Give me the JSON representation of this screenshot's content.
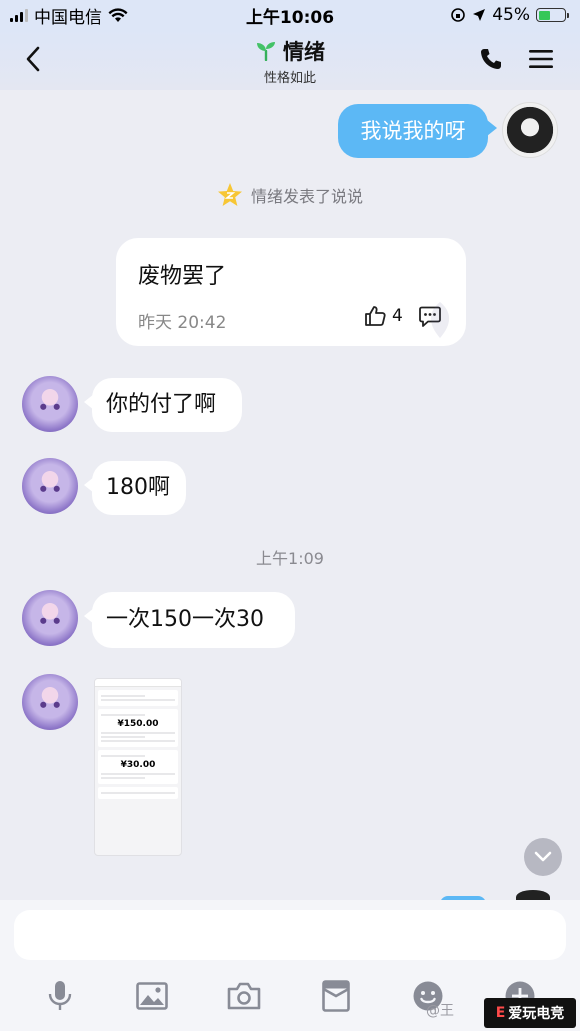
{
  "status_bar": {
    "carrier": "中国电信",
    "time": "上午10:06",
    "battery": "45%",
    "battery_level": 0.45
  },
  "nav": {
    "title": "情绪",
    "subtitle": "性格如此",
    "icons": [
      "back-icon",
      "sprout-icon",
      "phone-icon",
      "menu-icon"
    ]
  },
  "messages": {
    "self_1": "我说我的呀",
    "system_notice": "情绪发表了说说",
    "post": {
      "text": "废物罢了",
      "time": "昨天 20:42",
      "likes": "4"
    },
    "left_1": "你的付了啊",
    "left_2": "180啊",
    "time_divider": "上午1:09",
    "left_3": "一次150一次30"
  },
  "shared_image": {
    "amount_1": "¥150.00",
    "amount_2": "¥30.00"
  },
  "toolbar": {
    "icons": [
      "microphone-icon",
      "image-icon",
      "camera-icon",
      "red-packet-icon",
      "emoji-icon",
      "plus-icon"
    ]
  },
  "watermark": {
    "text": "@王",
    "logo_text": "爱玩电竞"
  },
  "colors": {
    "self_bubble": "#5cb8f5",
    "background": "#ecedf3",
    "battery_fill": "#35c759"
  }
}
